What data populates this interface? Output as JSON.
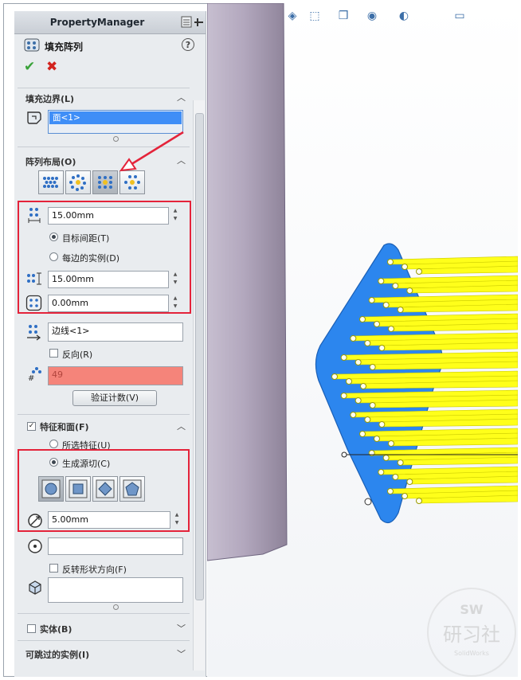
{
  "panel": {
    "title": "PropertyManager",
    "feature_name": "填充阵列",
    "help": "?",
    "ok": "✔",
    "cancel": "✖"
  },
  "fill_boundary": {
    "title": "填充边界(L)",
    "selection": "面<1>"
  },
  "pattern_layout": {
    "title": "阵列布局(O)",
    "layout_buttons": [
      "perforation",
      "circular",
      "square",
      "polygon"
    ],
    "selected_layout": "square",
    "spacing_value": "15.00mm",
    "target_spacing_label": "目标间距(T)",
    "instances_per_side_label": "每边的实例(D)",
    "target_spacing_selected": true,
    "loop_spacing_value": "15.00mm",
    "margin_value": "0.00mm",
    "direction_selection": "边线<1>",
    "flip_label": "反向(R)",
    "instance_count": "49",
    "verify_button": "验证计数(V)"
  },
  "features_faces": {
    "title": "特征和面(F)",
    "checked": true,
    "selected_features_label": "所选特征(U)",
    "create_seed_label": "生成源切(C)",
    "create_seed_selected": true,
    "shape_buttons": [
      "circle",
      "square",
      "diamond",
      "polygon"
    ],
    "selected_shape": "circle",
    "diameter_value": "5.00mm",
    "vertex_selection": "",
    "flip_shape_label": "反转形状方向(F)"
  },
  "bodies": {
    "title": "实体(B)",
    "checked": false
  },
  "instances_to_skip": {
    "title": "可跳过的实例(I)"
  },
  "watermark": {
    "top": "SW",
    "middle": "研习社",
    "bottom": "SolidWorks"
  },
  "colors": {
    "selection_blue": "#3f8ef7",
    "count_red": "#f5847a",
    "annotation_red": "#e4233a",
    "face_blue": "#2c86ee",
    "pin_yellow": "#ffff1a"
  }
}
